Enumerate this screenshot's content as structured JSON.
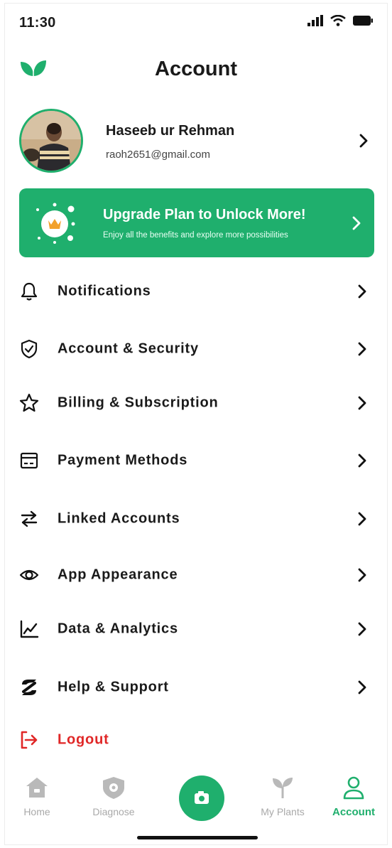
{
  "status_bar": {
    "time": "11:30"
  },
  "header": {
    "title": "Account"
  },
  "profile": {
    "name": "Haseeb ur Rehman",
    "email": "raoh2651@gmail.com"
  },
  "upgrade": {
    "title": "Upgrade Plan to Unlock More!",
    "subtitle": "Enjoy all the benefits and explore more possibilities"
  },
  "menu": [
    {
      "label": "Notifications",
      "icon": "bell-icon"
    },
    {
      "label": "Account & Security",
      "icon": "shield-check-icon"
    },
    {
      "label": "Billing & Subscription",
      "icon": "star-icon"
    },
    {
      "label": "Payment Methods",
      "icon": "card-icon"
    },
    {
      "label": "Linked Accounts",
      "icon": "swap-arrows-icon"
    },
    {
      "label": "App Appearance",
      "icon": "eye-icon"
    },
    {
      "label": "Data & Analytics",
      "icon": "chart-line-icon"
    },
    {
      "label": "Help & Support",
      "icon": "help-icon"
    },
    {
      "label": "Logout",
      "icon": "logout-icon"
    }
  ],
  "nav": [
    {
      "label": "Home",
      "icon": "home-icon",
      "active": false
    },
    {
      "label": "Diagnose",
      "icon": "diagnose-icon",
      "active": false
    },
    {
      "label": "",
      "icon": "camera-icon",
      "active": false
    },
    {
      "label": "My Plants",
      "icon": "sprout-icon",
      "active": false
    },
    {
      "label": "Account",
      "icon": "user-icon",
      "active": true
    }
  ],
  "colors": {
    "accent": "#1faf6d",
    "danger": "#e02727",
    "inactive": "#a9a9a9"
  }
}
